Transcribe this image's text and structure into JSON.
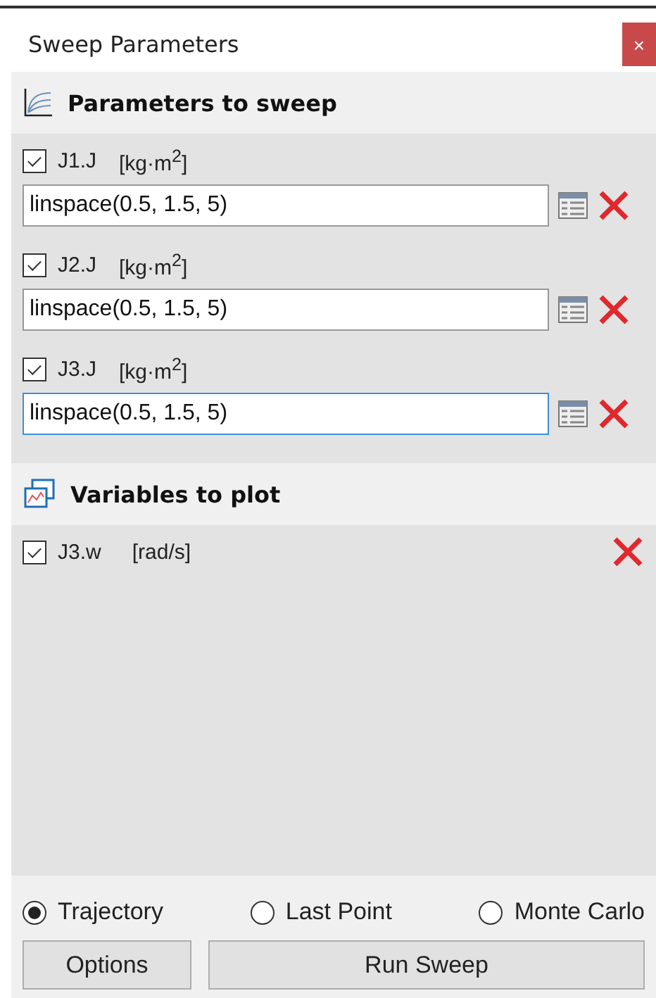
{
  "window": {
    "title": "Sweep Parameters",
    "close_label": "×"
  },
  "parameters_section": {
    "title": "Parameters to sweep"
  },
  "parameters": [
    {
      "name": "J1.J",
      "unit": "[kg·m$^{2}$]",
      "checked": true,
      "value": "linspace(0.5, 1.5, 5)",
      "focused": false
    },
    {
      "name": "J2.J",
      "unit": "[kg·m$^{2}$]",
      "checked": true,
      "value": "linspace(0.5, 1.5, 5)",
      "focused": false
    },
    {
      "name": "J3.J",
      "unit": "[kg·m$^{2}$]",
      "checked": true,
      "value": "linspace(0.5, 1.5, 5)",
      "focused": true
    }
  ],
  "variables_section": {
    "title": "Variables to plot"
  },
  "variables": [
    {
      "name": "J3.w",
      "unit": "[rad/s]",
      "checked": true
    }
  ],
  "modes": [
    {
      "label": "Trajectory",
      "selected": true
    },
    {
      "label": "Last Point",
      "selected": false
    },
    {
      "label": "Monte Carlo",
      "selected": false
    }
  ],
  "buttons": [
    {
      "label": "Options",
      "kind": "small"
    },
    {
      "label": "Run Sweep",
      "kind": "wide"
    }
  ]
}
